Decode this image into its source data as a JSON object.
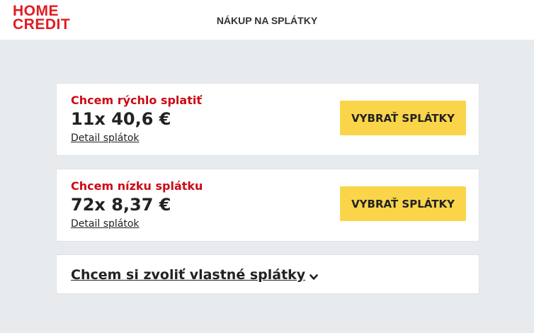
{
  "header": {
    "logo_line1": "HOME",
    "logo_line2": "CREDIT",
    "title": "NÁKUP NA SPLÁTKY"
  },
  "options": [
    {
      "subtitle": "Chcem rýchlo splatiť",
      "amount": "11x 40,6 €",
      "detail_link": "Detail splátok",
      "button_label": "VYBRAŤ SPLÁTKY"
    },
    {
      "subtitle": "Chcem nízku splátku",
      "amount": "72x 8,37 €",
      "detail_link": "Detail splátok",
      "button_label": "VYBRAŤ SPLÁTKY"
    }
  ],
  "custom_option": {
    "label": "Chcem si zvoliť vlastné splátky",
    "icon": "chevron-down-icon"
  },
  "colors": {
    "brand_red": "#e21a23",
    "accent_red": "#cc0a14",
    "button_yellow": "#fad54a",
    "background": "#e8ebee"
  }
}
